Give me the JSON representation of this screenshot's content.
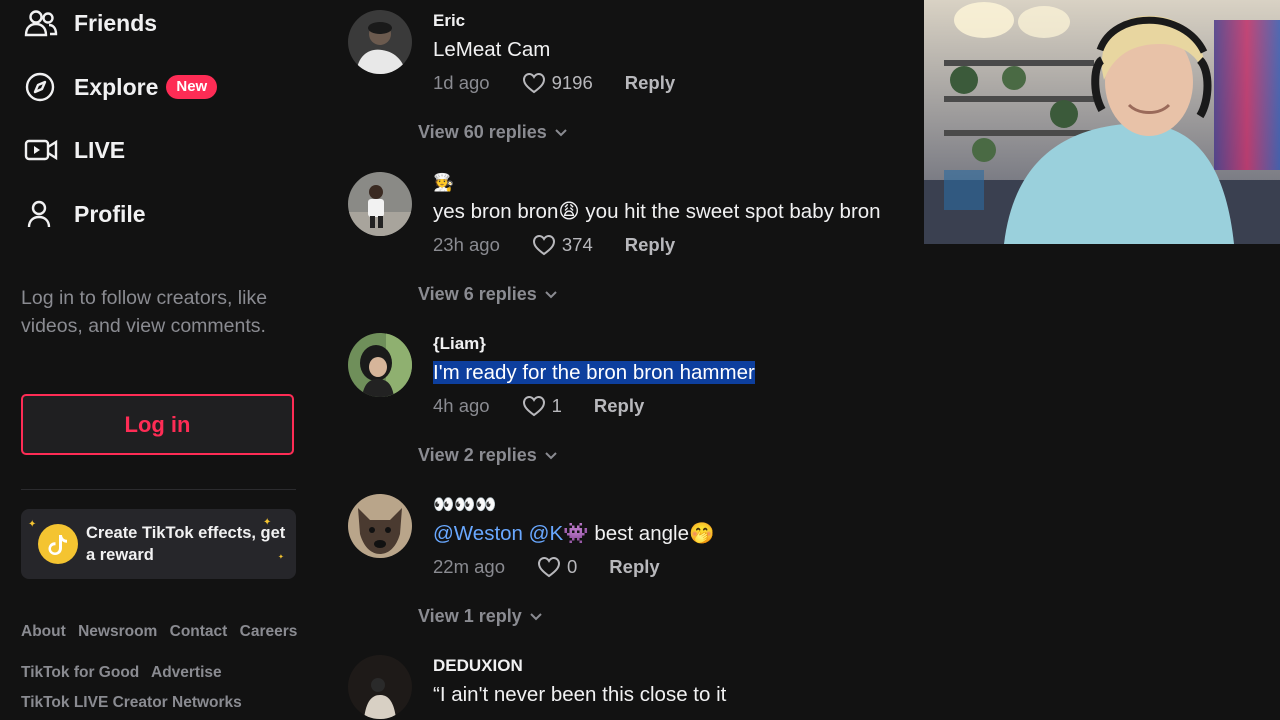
{
  "sidebar": {
    "nav": [
      {
        "label": "Friends",
        "icon": "friends-icon"
      },
      {
        "label": "Explore",
        "icon": "compass-icon",
        "badge": "New"
      },
      {
        "label": "LIVE",
        "icon": "live-video-icon"
      },
      {
        "label": "Profile",
        "icon": "profile-icon"
      }
    ],
    "login_prompt": "Log in to follow creators, like videos, and view comments.",
    "login_button": "Log in",
    "effects_card": "Create TikTok effects, get a reward",
    "footer": {
      "row1": [
        "About",
        "Newsroom",
        "Contact",
        "Careers"
      ],
      "row2": [
        "TikTok for Good",
        "Advertise"
      ],
      "row3": [
        "TikTok LIVE Creator Networks"
      ]
    }
  },
  "comments": [
    {
      "author": "Eric",
      "text": "LeMeat Cam",
      "time": "1d ago",
      "likes": "9196",
      "reply": "Reply",
      "view_replies": "View 60 replies"
    },
    {
      "author": "🧑‍🍳",
      "text_before": "yes bron bron",
      "emoji": "😩",
      "text_after": " you hit the sweet spot baby bron",
      "time": "23h ago",
      "likes": "374",
      "reply": "Reply",
      "view_replies": "View 6 replies"
    },
    {
      "author": "{Liam}",
      "text": "I'm ready for the bron bron hammer",
      "time": "4h ago",
      "likes": "1",
      "reply": "Reply",
      "view_replies": "View 2 replies"
    },
    {
      "author": "👀👀👀",
      "mention1": "@Weston",
      "mention2": "@K",
      "mention_emoji": "👾",
      "text": " best angle",
      "emoji": "🤭",
      "time": "22m ago",
      "likes": "0",
      "reply": "Reply",
      "view_replies": "View 1 reply"
    },
    {
      "author": "DEDUXION",
      "text": "“I ain't never been this close to it"
    }
  ],
  "colors": {
    "background": "#121212",
    "accent": "#fe2c55",
    "muted_text": "#8a8b91",
    "mention": "#69a8ff",
    "selection": "#0d3f9e"
  }
}
